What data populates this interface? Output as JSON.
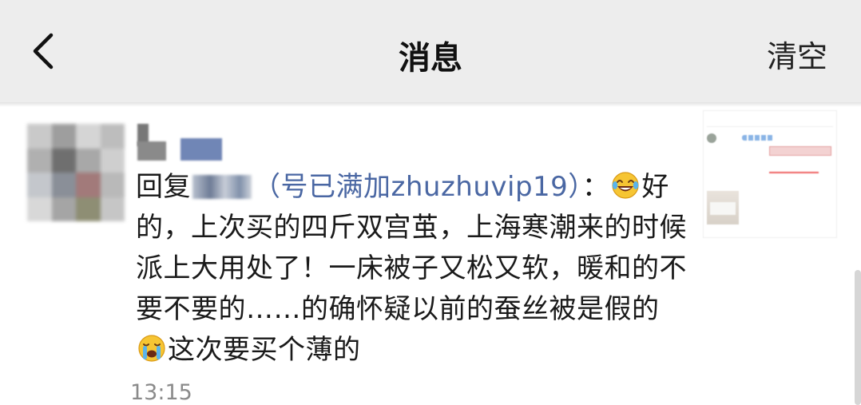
{
  "header": {
    "title": "消息",
    "clear_label": "清空"
  },
  "message": {
    "reply_prefix": "回复",
    "reply_tag": "（号已满加zhuzhuvip19）",
    "colon": "：",
    "part1": "好的，上次买的四斤双宫茧，上海寒潮来的时候派上大用处了！一床被子又松又软，暖和的不要不要的……的确怀疑以前的蚕丝被是假的",
    "part2": "这次要买个薄的",
    "emoji_1": "tears-of-joy-emoji",
    "emoji_2": "loudly-crying-emoji",
    "time": "13:15"
  },
  "colors": {
    "header_bg": "#ededed",
    "link_blue": "#4a67a3",
    "timestamp_gray": "#8a8a8a"
  }
}
